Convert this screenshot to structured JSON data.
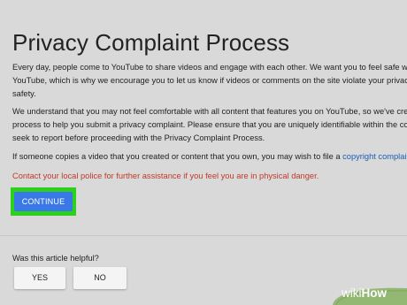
{
  "page": {
    "title": "Privacy Complaint Process",
    "paragraph_1": [
      "Every day, people come to YouTube to share videos and engage with each other. We want you to feel safe when",
      "YouTube, which is why we encourage you to let us know if videos or comments on the site violate your privacy c",
      "safety."
    ],
    "paragraph_2": [
      "We understand that you may not feel comfortable with all content that features you on YouTube, so we've create",
      "process to help you submit a privacy complaint. Please ensure that you are uniquely identifiable within the conte",
      "seek to report before proceeding with the Privacy Complaint Process."
    ],
    "paragraph_3_text": "If someone copies a video that you created or content that you own, you may wish to file a ",
    "paragraph_3_link": "copyright complaint",
    "paragraph_3_end": ".",
    "warning": "Contact your local police for further assistance if you feel you are in physical danger.",
    "continue_label": "CONTINUE"
  },
  "feedback": {
    "question": "Was this article helpful?",
    "yes_label": "YES",
    "no_label": "NO"
  },
  "watermark": {
    "wiki": "wiki",
    "how": "How"
  },
  "colors": {
    "background": "#d9d9d9",
    "accent_button": "#3b78e7",
    "highlight": "#2bd11a",
    "warning_text": "#c0392b",
    "link": "#1a5fb4",
    "watermark_green": "#93b874"
  },
  "icons": {
    "watermark": "wikihow-leaf-logo"
  }
}
